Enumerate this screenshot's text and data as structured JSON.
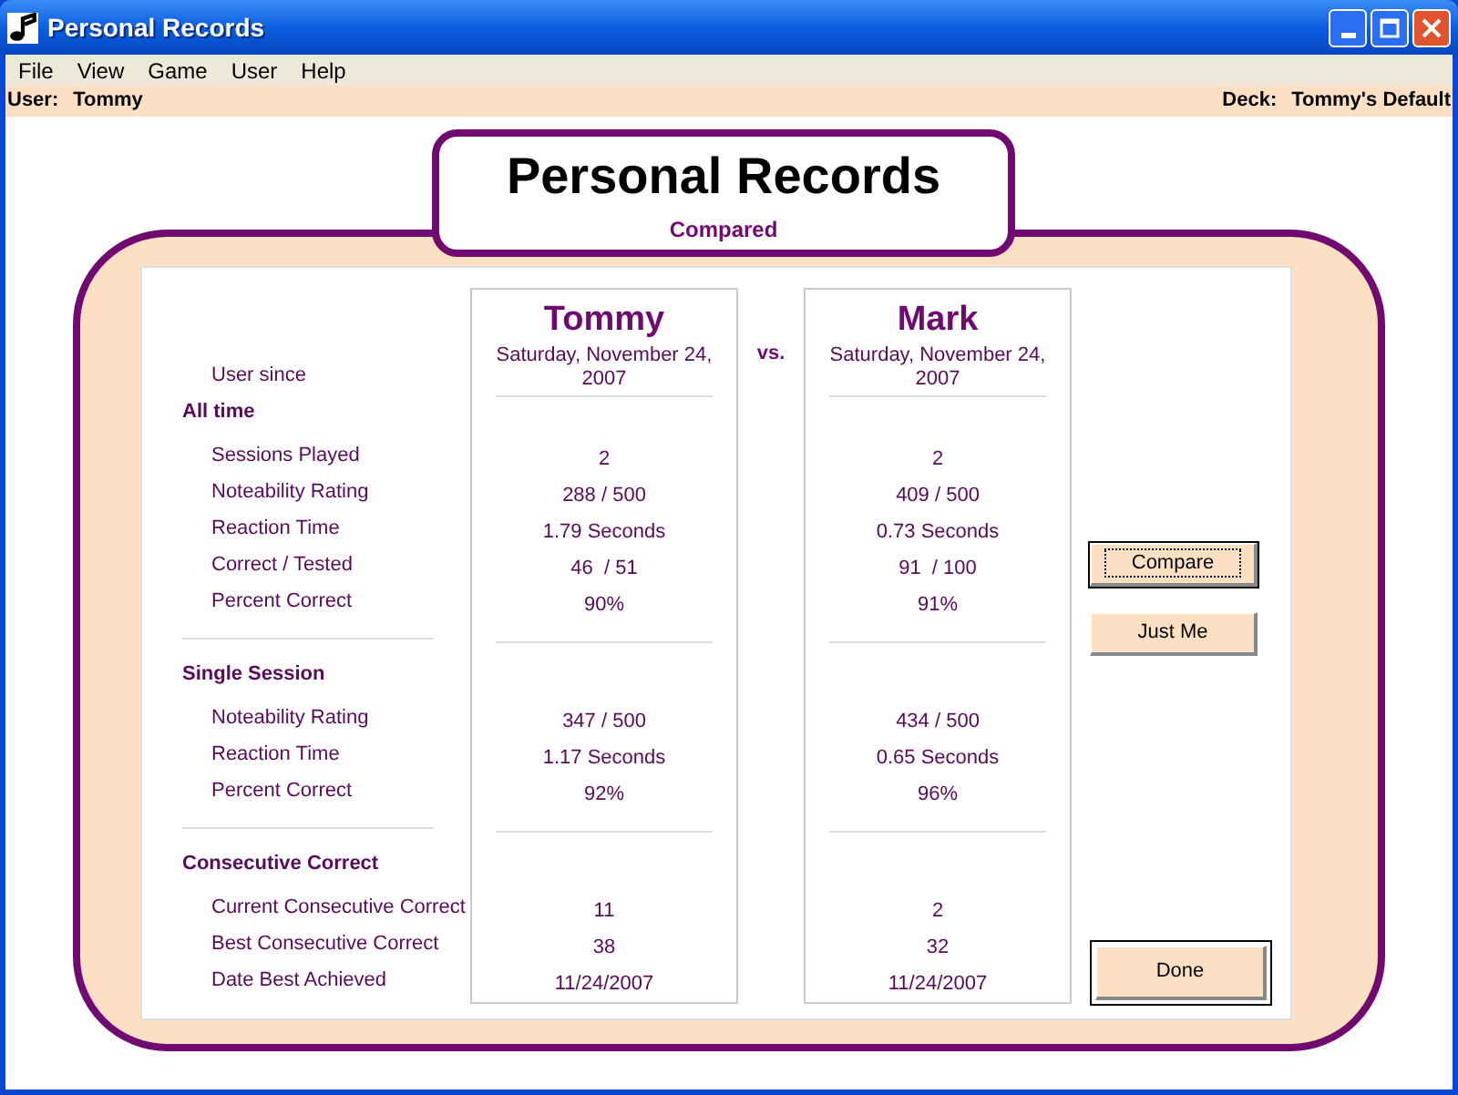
{
  "window": {
    "title": "Personal Records"
  },
  "menu": [
    "File",
    "View",
    "Game",
    "User",
    "Help"
  ],
  "info_bar": {
    "user_label": "User:",
    "user": "Tommy",
    "deck_label": "Deck:",
    "deck": "Tommy's Default"
  },
  "heading": {
    "title": "Personal Records",
    "subtitle": "Compared"
  },
  "since_label": "User since",
  "vs": "vs.",
  "players": [
    {
      "name": "Tommy",
      "since": "Saturday, November 24, 2007"
    },
    {
      "name": "Mark",
      "since": "Saturday, November 24, 2007"
    }
  ],
  "sections": [
    {
      "title": "All time",
      "rows": [
        {
          "label": "Sessions Played",
          "values": [
            "2",
            "2"
          ]
        },
        {
          "label": "Noteability Rating",
          "values": [
            "288 / 500",
            "409 / 500"
          ]
        },
        {
          "label": "Reaction Time",
          "values": [
            "1.79 Seconds",
            "0.73 Seconds"
          ]
        },
        {
          "label": "Correct / Tested",
          "values": [
            "46  / 51",
            "91  / 100"
          ]
        },
        {
          "label": "Percent Correct",
          "values": [
            "90%",
            "91%"
          ]
        }
      ]
    },
    {
      "title": "Single Session",
      "rows": [
        {
          "label": "Noteability Rating",
          "values": [
            "347 / 500",
            "434 / 500"
          ]
        },
        {
          "label": "Reaction Time",
          "values": [
            "1.17 Seconds",
            "0.65 Seconds"
          ]
        },
        {
          "label": "Percent Correct",
          "values": [
            "92%",
            "96%"
          ]
        }
      ]
    },
    {
      "title": "Consecutive Correct",
      "rows": [
        {
          "label": "Current Consecutive Correct",
          "values": [
            "11",
            "2"
          ]
        },
        {
          "label": "Best Consecutive Correct",
          "values": [
            "38",
            "32"
          ]
        },
        {
          "label": "Date Best Achieved",
          "values": [
            "11/24/2007",
            "11/24/2007"
          ]
        }
      ]
    }
  ],
  "buttons": [
    {
      "label": "Compare",
      "focused": true,
      "default": false
    },
    {
      "label": "Just Me",
      "focused": false,
      "default": false
    },
    {
      "label": "Done",
      "focused": false,
      "default": true
    }
  ]
}
